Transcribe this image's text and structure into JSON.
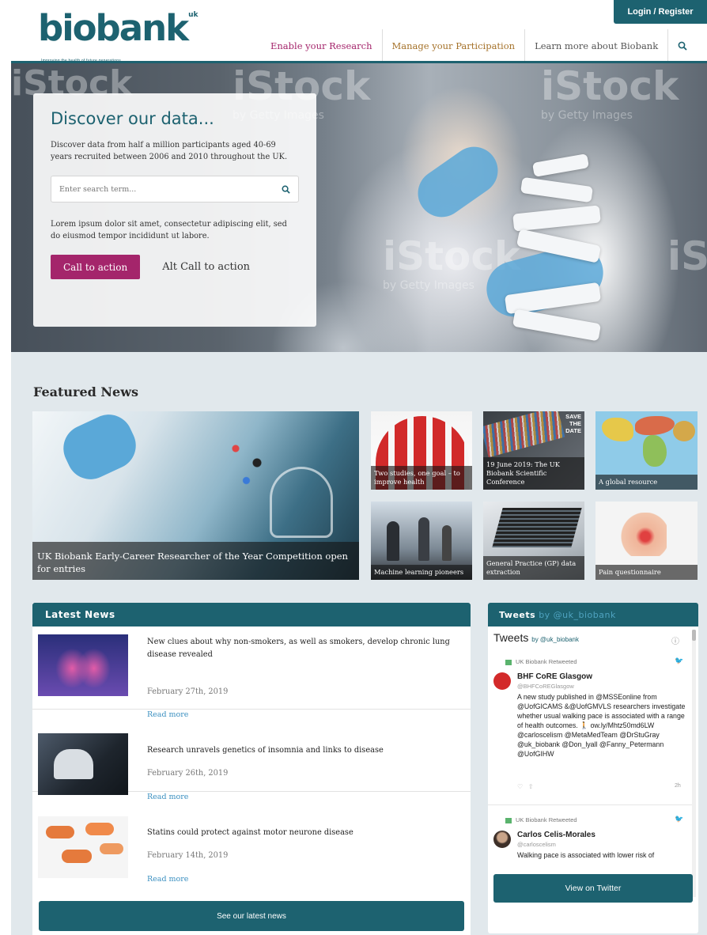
{
  "header": {
    "login_label": "Login / Register",
    "logo_text": "biobank",
    "logo_suffix": "uk",
    "logo_tagline": "Improving the health of future generations",
    "nav": [
      {
        "label": "Enable your Research",
        "color": "#a4256b"
      },
      {
        "label": "Manage your Participation",
        "color": "#a5722a"
      },
      {
        "label": "Learn more about Biobank",
        "color": "#555555"
      }
    ],
    "search_icon": "search-icon"
  },
  "hero": {
    "title": "Discover our data...",
    "intro": "Discover data from half a million participants aged 40-69 years recruited between 2006 and 2010 throughout the UK.",
    "search_placeholder": "Enter search term...",
    "lorem": "Lorem ipsum dolor sit amet, consectetur adipiscing elit, sed do eiusmod tempor incididunt ut labore.",
    "cta_label": "Call to action",
    "alt_cta_label": "Alt Call to action",
    "watermark_text": "iStock",
    "watermark_sub": "by Getty Images"
  },
  "featured": {
    "title": "Featured News",
    "tiles": [
      {
        "caption": "UK Biobank Early-Career Researcher of the Year Competition open for entries"
      },
      {
        "caption": "Two studies, one goal – to improve health"
      },
      {
        "caption": "19 June 2019: The UK Biobank Scientific Conference"
      },
      {
        "caption": "A global resource"
      },
      {
        "caption": "Machine learning pioneers"
      },
      {
        "caption": "General Practice (GP) data extraction"
      },
      {
        "caption": "Pain questionnaire"
      }
    ],
    "save_date": "SAVE THE DATE"
  },
  "latest_news": {
    "title": "Latest News",
    "items": [
      {
        "title": "New clues about why non-smokers, as well as smokers, develop chronic lung disease revealed",
        "date": "February 27th, 2019",
        "read_more": "Read more"
      },
      {
        "title": "Research unravels genetics of insomnia and links to disease",
        "date": "February 26th, 2019",
        "read_more": "Read more"
      },
      {
        "title": "Statins could protect against motor neurone disease",
        "date": "February 14th, 2019",
        "read_more": "Read more"
      }
    ],
    "see_all_label": "See our latest news"
  },
  "tweets": {
    "header": "Tweets",
    "header_by": "by @uk_biobank",
    "widget_title": "Tweets",
    "widget_by": "by @uk_biobank",
    "items": [
      {
        "retweeted": "UK Biobank Retweeted",
        "name": "BHF CoRE Glasgow",
        "handle": "@BHFCoREGlasgow",
        "text": "A new study published in @MSSEonline from @UofGICAMS &@UofGMVLS researchers investigate whether usual walking pace is associated with a range of health outcomes. 🚶 ow.ly/Mhtz50md6LW @carloscelism @MetaMedTeam @DrStuGray @uk_biobank @Don_lyall @Fanny_Petermann @UofGIHW",
        "time": "2h"
      },
      {
        "retweeted": "UK Biobank Retweeted",
        "name": "Carlos Celis-Morales",
        "handle": "@carloscelism",
        "text": "Walking pace is associated with lower risk of"
      }
    ],
    "view_label": "View on Twitter"
  }
}
